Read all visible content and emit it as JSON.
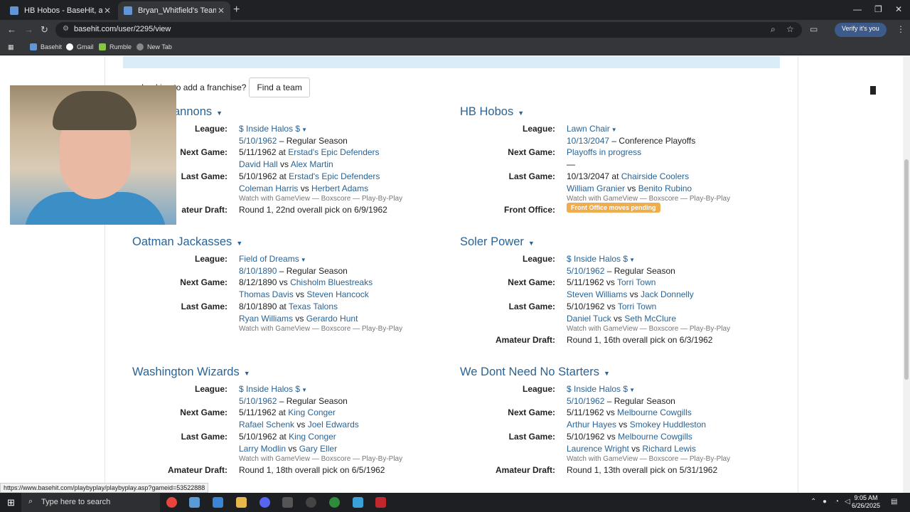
{
  "browser": {
    "tabs": [
      {
        "title": "HB Hobos - BaseHit, a free sim",
        "active": false
      },
      {
        "title": "Bryan_Whitfield's Teams - BaseHit",
        "active": true
      }
    ],
    "url": "basehit.com/user/2295/view",
    "verify_label": "Verify it's you",
    "bookmarks": [
      "Basehit",
      "Gmail",
      "Rumble",
      "New Tab"
    ]
  },
  "page": {
    "add_franchise_text": "Looking to add a franchise?",
    "find_team_label": "Find a team"
  },
  "labels": {
    "league": "League:",
    "next_game": "Next Game:",
    "last_game": "Last Game:",
    "amateur_draft": "Amateur Draft:",
    "front_office": "Front Office:",
    "watch": "Watch with GameView",
    "boxscore": "Boxscore",
    "pbp": "Play-By-Play",
    "dash": "—",
    "vs": "vs"
  },
  "teams": [
    {
      "name": "annons",
      "league": "$ Inside Halos $",
      "season_date": "5/10/1962",
      "season_type": "– Regular Season",
      "next_pre": "5/11/1962 at",
      "next_opp": "Erstad's Epic Defenders",
      "next_p1": "David Hall",
      "next_p2": "Alex Martin",
      "last_pre": "5/10/1962 at",
      "last_opp": "Erstad's Epic Defenders",
      "last_p1": "Coleman Harris",
      "last_p2": "Herbert Adams",
      "draft_label": "ateur Draft:",
      "draft": "Round 1, 22nd overall pick on 6/9/1962"
    },
    {
      "name": "HB Hobos",
      "league": "Lawn Chair",
      "season_date": "10/13/2047",
      "season_type": "– Conference Playoffs",
      "next_text": "Playoffs in progress",
      "last_pre": "10/13/2047 at",
      "last_opp": "Chairside Coolers",
      "last_p1": "William Granier",
      "last_p2": "Benito Rubino",
      "front_office": "Front Office moves pending"
    },
    {
      "name": "Oatman Jackasses",
      "league": "Field of Dreams",
      "season_date": "8/10/1890",
      "season_type": "– Regular Season",
      "next_pre": "8/12/1890 vs",
      "next_opp": "Chisholm Bluestreaks",
      "next_p1": "Thomas Davis",
      "next_p2": "Steven Hancock",
      "last_pre": "8/10/1890 at",
      "last_opp": "Texas Talons",
      "last_p1": "Ryan Williams",
      "last_p2": "Gerardo Hunt"
    },
    {
      "name": "Soler Power",
      "league": "$ Inside Halos $",
      "season_date": "5/10/1962",
      "season_type": "– Regular Season",
      "next_pre": "5/11/1962 vs",
      "next_opp": "Torri Town",
      "next_p1": "Steven Williams",
      "next_p2": "Jack Donnelly",
      "last_pre": "5/10/1962 vs",
      "last_opp": "Torri Town",
      "last_p1": "Daniel Tuck",
      "last_p2": "Seth McClure",
      "draft": "Round 1, 16th overall pick on 6/3/1962"
    },
    {
      "name": "Washington Wizards",
      "league": "$ Inside Halos $",
      "season_date": "5/10/1962",
      "season_type": "– Regular Season",
      "next_pre": "5/11/1962 at",
      "next_opp": "King Conger",
      "next_p1": "Rafael Schenk",
      "next_p2": "Joel Edwards",
      "last_pre": "5/10/1962 at",
      "last_opp": "King Conger",
      "last_p1": "Larry Modlin",
      "last_p2": "Gary Eller",
      "draft": "Round 1, 18th overall pick on 6/5/1962"
    },
    {
      "name": "We Dont Need No Starters",
      "league": "$ Inside Halos $",
      "season_date": "5/10/1962",
      "season_type": "– Regular Season",
      "next_pre": "5/11/1962 vs",
      "next_opp": "Melbourne Cowgills",
      "next_p1": "Arthur Hayes",
      "next_p2": "Smokey Huddleston",
      "last_pre": "5/10/1962 vs",
      "last_opp": "Melbourne Cowgills",
      "last_p1": "Laurence Wright",
      "last_p2": "Richard Lewis",
      "draft": "Round 1, 13th overall pick on 5/31/1962"
    }
  ],
  "status_url": "https://www.basehit.com/playbyplay/playbyplay.asp?gameid=53522888",
  "taskbar": {
    "search_placeholder": "Type here to search",
    "time": "9:05 AM",
    "date": "6/26/2025"
  }
}
